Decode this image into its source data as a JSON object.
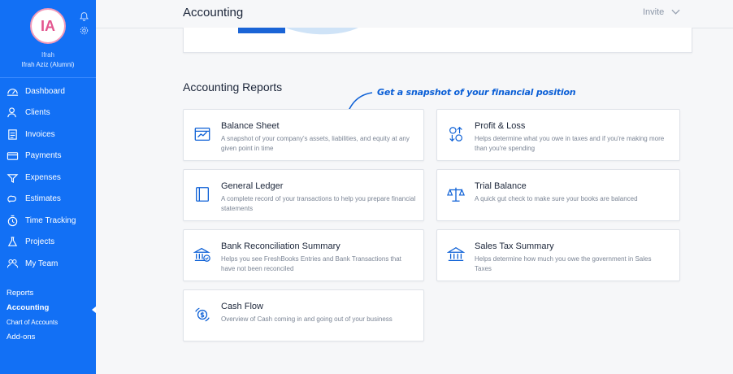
{
  "user": {
    "initials": "IA",
    "name": "Ifrah",
    "subtitle": "Ifrah Aziz (Alumni)"
  },
  "nav": [
    {
      "label": "Dashboard",
      "icon": "dashboard-icon"
    },
    {
      "label": "Clients",
      "icon": "clients-icon"
    },
    {
      "label": "Invoices",
      "icon": "invoices-icon"
    },
    {
      "label": "Payments",
      "icon": "payments-icon"
    },
    {
      "label": "Expenses",
      "icon": "expenses-icon"
    },
    {
      "label": "Estimates",
      "icon": "estimates-icon"
    },
    {
      "label": "Time Tracking",
      "icon": "time-tracking-icon"
    },
    {
      "label": "Projects",
      "icon": "projects-icon"
    },
    {
      "label": "My Team",
      "icon": "team-icon"
    }
  ],
  "subnav": {
    "reports": "Reports",
    "accounting": "Accounting",
    "chart_of_accounts": "Chart of Accounts",
    "addons": "Add-ons"
  },
  "header": {
    "title": "Accounting",
    "invite": "Invite"
  },
  "section": {
    "title": "Accounting Reports",
    "annotation": "Get a snapshot of your financial position"
  },
  "reports": [
    {
      "title": "Balance Sheet",
      "desc": "A snapshot of your company's assets, liabilities, and equity at any given point in time",
      "icon": "balance-sheet-icon"
    },
    {
      "title": "Profit & Loss",
      "desc": "Helps determine what you owe in taxes and if you're making more than you're spending",
      "icon": "profit-loss-icon"
    },
    {
      "title": "General Ledger",
      "desc": "A complete record of your transactions to help you prepare financial statements",
      "icon": "ledger-icon"
    },
    {
      "title": "Trial Balance",
      "desc": "A quick gut check to make sure your books are balanced",
      "icon": "scale-icon"
    },
    {
      "title": "Bank Reconciliation Summary",
      "desc": "Helps you see FreshBooks Entries and Bank Transactions that have not been reconciled",
      "icon": "bank-reconciliation-icon"
    },
    {
      "title": "Sales Tax Summary",
      "desc": "Helps determine how much you owe the government in Sales Taxes",
      "icon": "bank-icon"
    },
    {
      "title": "Cash Flow",
      "desc": "Overview of Cash coming in and going out of your business",
      "icon": "cash-flow-icon"
    }
  ],
  "colors": {
    "sidebar": "#1270f5",
    "accent": "#0b5fd6",
    "avatar_ring": "#f39ab9"
  }
}
